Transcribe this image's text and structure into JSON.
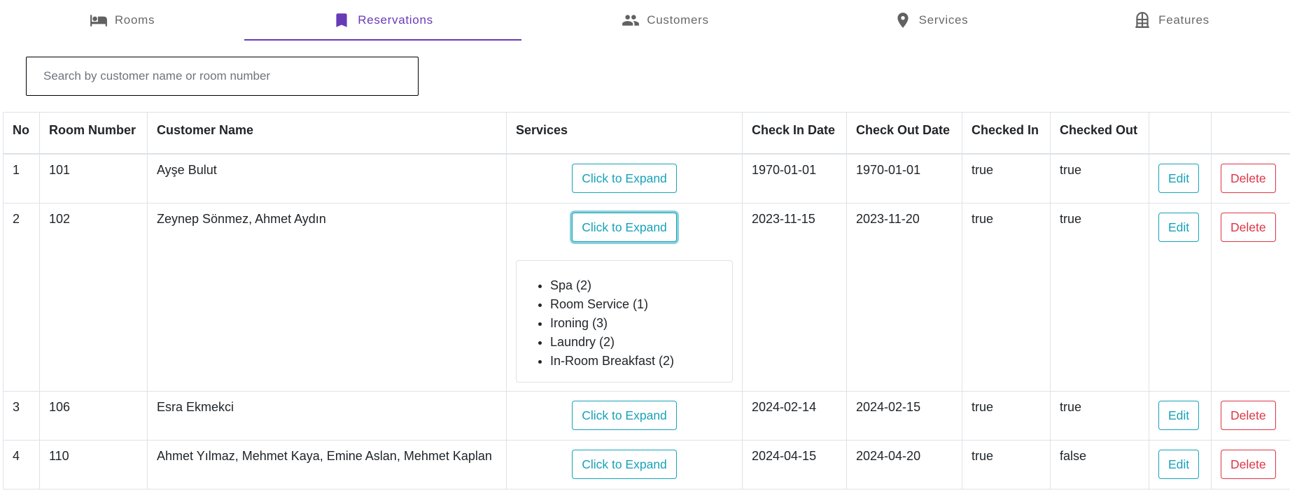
{
  "nav": {
    "tabs": [
      {
        "label": "Rooms",
        "icon": "bed-icon",
        "active": false
      },
      {
        "label": "Reservations",
        "icon": "bookmark-icon",
        "active": true
      },
      {
        "label": "Customers",
        "icon": "people-icon",
        "active": false
      },
      {
        "label": "Services",
        "icon": "location-pin-icon",
        "active": false
      },
      {
        "label": "Features",
        "icon": "building-icon",
        "active": false
      }
    ],
    "accent_color": "#673ab7"
  },
  "search": {
    "placeholder": "Search by customer name or room number",
    "value": ""
  },
  "table": {
    "headers": [
      "No",
      "Room Number",
      "Customer Name",
      "Services",
      "Check In Date",
      "Check Out Date",
      "Checked In",
      "Checked Out",
      "",
      ""
    ],
    "expand_label": "Click to Expand",
    "edit_label": "Edit",
    "delete_label": "Delete",
    "rows": [
      {
        "no": "1",
        "room": "101",
        "customer": "Ayşe Bulut",
        "check_in": "1970-01-01",
        "check_out": "1970-01-01",
        "checked_in": "true",
        "checked_out": "true"
      },
      {
        "no": "2",
        "room": "102",
        "customer": "Zeynep Sönmez, Ahmet Aydın",
        "check_in": "2023-11-15",
        "check_out": "2023-11-20",
        "checked_in": "true",
        "checked_out": "true",
        "services": [
          "Spa (2)",
          "Room Service (1)",
          "Ironing (3)",
          "Laundry (2)",
          "In-Room Breakfast (2)"
        ]
      },
      {
        "no": "3",
        "room": "106",
        "customer": "Esra Ekmekci",
        "check_in": "2024-02-14",
        "check_out": "2024-02-15",
        "checked_in": "true",
        "checked_out": "true"
      },
      {
        "no": "4",
        "room": "110",
        "customer": "Ahmet Yılmaz, Mehmet Kaya, Emine Aslan, Mehmet Kaplan",
        "check_in": "2024-04-15",
        "check_out": "2024-04-20",
        "checked_in": "true",
        "checked_out": "false"
      }
    ]
  },
  "colors": {
    "info": "#17a2b8",
    "danger": "#dc3545"
  }
}
